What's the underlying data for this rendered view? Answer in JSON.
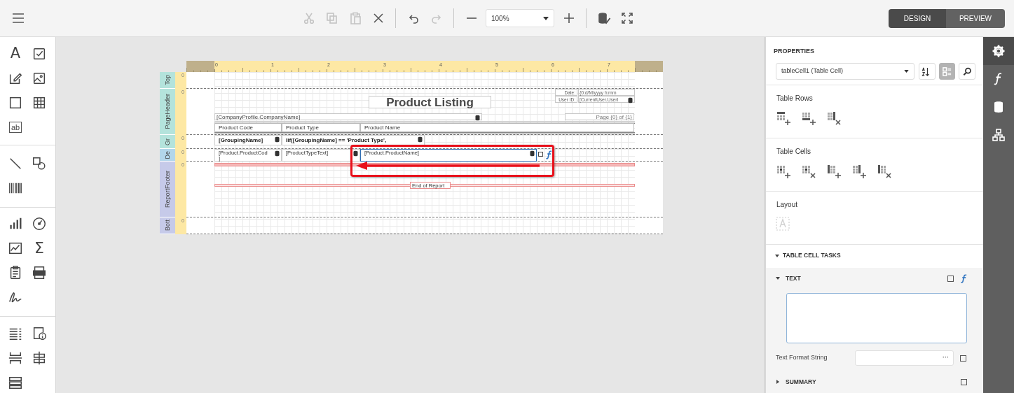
{
  "toolbar": {
    "groups": [
      [
        {
          "kind": "cut",
          "disabled": true
        },
        {
          "kind": "copy",
          "disabled": true
        },
        {
          "kind": "paste",
          "disabled": true
        },
        {
          "kind": "delete",
          "disabled": false
        }
      ],
      [
        {
          "kind": "undo",
          "disabled": false
        },
        {
          "kind": "redo",
          "disabled": true
        }
      ],
      [
        {
          "kind": "zoom_out",
          "disabled": false
        },
        {
          "kind": "zoom",
          "value": "100%",
          "disabled": false
        },
        {
          "kind": "zoom_in",
          "disabled": false
        }
      ],
      [
        {
          "kind": "validate",
          "disabled": false
        },
        {
          "kind": "fullscreen",
          "disabled": false
        }
      ]
    ],
    "modes": [
      {
        "label": "DESIGN",
        "selected": true
      },
      {
        "label": "PREVIEW",
        "selected": false
      }
    ]
  },
  "toolbox": {
    "groups": [
      [
        {
          "kind": "label",
          "glyph": "A"
        },
        {
          "kind": "checkbox"
        },
        {
          "kind": "richtext"
        },
        {
          "kind": "picture"
        },
        {
          "kind": "panel"
        },
        {
          "kind": "table"
        },
        {
          "kind": "text_box",
          "glyph": "ab"
        }
      ],
      [
        {
          "kind": "line"
        },
        {
          "kind": "shapes"
        },
        {
          "kind": "barcode"
        }
      ],
      [
        {
          "kind": "chart"
        },
        {
          "kind": "gauge"
        },
        {
          "kind": "sparkline"
        },
        {
          "kind": "summary",
          "glyph": "Σ"
        },
        {
          "kind": "subreport"
        },
        {
          "kind": "pdf"
        },
        {
          "kind": "signature"
        }
      ],
      [
        {
          "kind": "toc"
        },
        {
          "kind": "page_info"
        },
        {
          "kind": "page_break"
        },
        {
          "kind": "cross_band"
        },
        {
          "kind": "bands"
        }
      ]
    ]
  },
  "report": {
    "ruler_labels": [
      "0",
      "1",
      "2",
      "3",
      "4",
      "5",
      "6",
      "7"
    ],
    "bands": [
      {
        "label": "Top",
        "color": "#b4e3dc",
        "ruler_label": "0"
      },
      {
        "label": "PageHeader",
        "color": "#b4e3dc",
        "ruler_label": "0"
      },
      {
        "label": "Gr",
        "color": "#b4e3dc",
        "ruler_label": "0"
      },
      {
        "label": "De",
        "color": "#b2d6ea",
        "ruler_label": "0"
      },
      {
        "label": "ReportFooter",
        "color": "#c6cae9",
        "ruler_label": "0"
      },
      {
        "label": "Bott",
        "color": "#c6cae9",
        "ruler_label": "0"
      }
    ],
    "controls": [
      {
        "kind": "title",
        "text": "Product Listing",
        "bound": false,
        "selected": false
      },
      {
        "kind": "caption",
        "text": "Date:",
        "bound": false,
        "selected": false
      },
      {
        "kind": "field",
        "text": "{0:d/M/yyyy h:mm",
        "bound": false,
        "selected": false
      },
      {
        "kind": "caption",
        "text": "User ID:",
        "bound": false,
        "selected": false
      },
      {
        "kind": "field",
        "text": "[CurrentUser.UserI",
        "bound": true,
        "selected": false
      },
      {
        "kind": "text",
        "text": "[CompanyProfile.CompanyName]",
        "bound": true,
        "selected": false
      },
      {
        "kind": "page_info",
        "text": "Page {0} of {1}",
        "bound": false,
        "selected": false
      },
      {
        "kind": "header_cell",
        "text": "Product Code",
        "bound": false,
        "selected": false
      },
      {
        "kind": "header_cell",
        "text": "Product Type",
        "bound": false,
        "selected": false
      },
      {
        "kind": "header_cell",
        "text": "Product Name",
        "bound": false,
        "selected": false
      },
      {
        "kind": "group_cell",
        "text": "[GroupingName]",
        "bound": true,
        "selected": false
      },
      {
        "kind": "group_cell",
        "text": "Iif([GroupingName] == 'Product Type',",
        "bound": true,
        "selected": false
      },
      {
        "kind": "cell",
        "text": "[Product.ProductCod\n]",
        "bound": true,
        "selected": false
      },
      {
        "kind": "cell",
        "text": "[ProductTypeText]",
        "bound": true,
        "selected": false
      },
      {
        "kind": "cell",
        "text": "[Product.ProductName]",
        "bound": true,
        "selected": true
      },
      {
        "kind": "footer_label",
        "text": "End of Report",
        "bound": false,
        "selected": false
      }
    ]
  },
  "properties": {
    "title": "PROPERTIES",
    "selector": "tableCell1 (Table Cell)",
    "view_buttons": [
      {
        "kind": "sort",
        "selected": false
      },
      {
        "kind": "categories",
        "selected": true
      },
      {
        "kind": "search",
        "selected": false
      }
    ],
    "sections": [
      {
        "title": "Table Rows",
        "actions": [
          {
            "kind": "row_above",
            "disabled": false
          },
          {
            "kind": "row_below",
            "disabled": false
          },
          {
            "kind": "row_delete",
            "disabled": false
          }
        ]
      },
      {
        "title": "Table Cells",
        "actions": [
          {
            "kind": "cell_insert",
            "disabled": false
          },
          {
            "kind": "cell_delete",
            "disabled": false
          },
          {
            "kind": "col_left",
            "disabled": false
          },
          {
            "kind": "col_right",
            "disabled": false
          },
          {
            "kind": "col_delete",
            "disabled": false
          }
        ]
      },
      {
        "title": "Layout",
        "actions": [
          {
            "kind": "fit_text",
            "disabled": true
          }
        ]
      }
    ],
    "tasks": {
      "title": "TABLE CELL TASKS",
      "expanded": true,
      "groups": [
        {
          "title": "TEXT",
          "expanded": true
        },
        {
          "title": "SUMMARY",
          "expanded": false
        }
      ],
      "format_label": "Text Format String",
      "format_button": "···"
    }
  },
  "side_tabs": [
    {
      "kind": "properties",
      "selected": true
    },
    {
      "kind": "expressions",
      "selected": false
    },
    {
      "kind": "data",
      "selected": false
    },
    {
      "kind": "structure",
      "selected": false
    }
  ]
}
